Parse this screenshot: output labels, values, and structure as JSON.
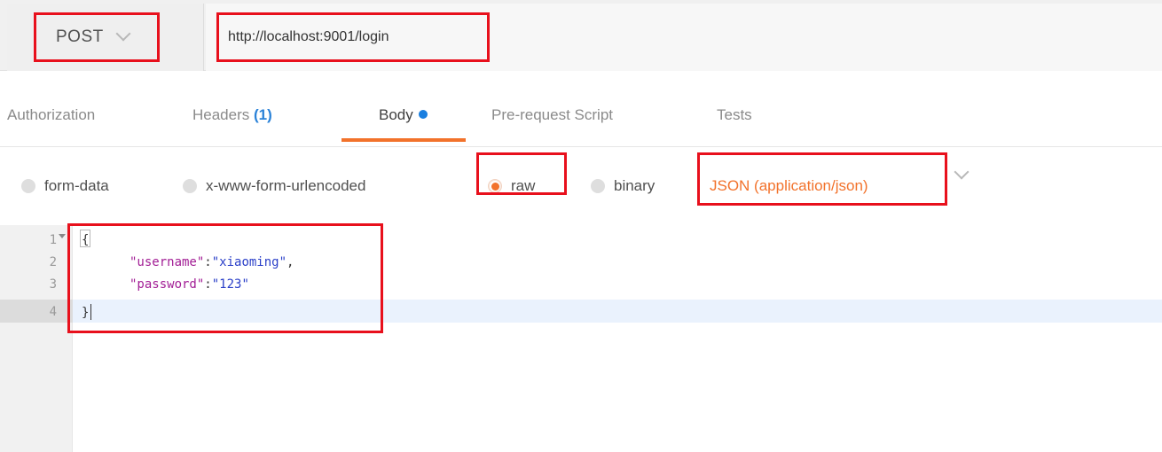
{
  "request": {
    "method": "POST",
    "url": "http://localhost:9001/login"
  },
  "tabs": [
    {
      "label": "Authorization"
    },
    {
      "label": "Headers",
      "count": "(1)"
    },
    {
      "label": "Body",
      "active": true
    },
    {
      "label": "Pre-request Script"
    },
    {
      "label": "Tests"
    }
  ],
  "body_options": [
    {
      "label": "form-data",
      "selected": false
    },
    {
      "label": "x-www-form-urlencoded",
      "selected": false
    },
    {
      "label": "raw",
      "selected": true
    },
    {
      "label": "binary",
      "selected": false
    }
  ],
  "content_type": "JSON (application/json)",
  "editor": {
    "line_numbers": [
      "1",
      "2",
      "3",
      "4"
    ],
    "lines": {
      "l1": "{",
      "l2_key": "\"username\"",
      "l2_sep": ":",
      "l2_val": "\"xiaoming\"",
      "l2_end": ",",
      "l3_key": "\"password\"",
      "l3_sep": ":",
      "l3_val": "\"123\"",
      "l4": "}"
    }
  },
  "colors": {
    "accent": "#f2722b",
    "annotation": "#e8101c",
    "json_key": "#a21e95",
    "json_string": "#2a3fc8",
    "badge": "#2a82d8"
  }
}
